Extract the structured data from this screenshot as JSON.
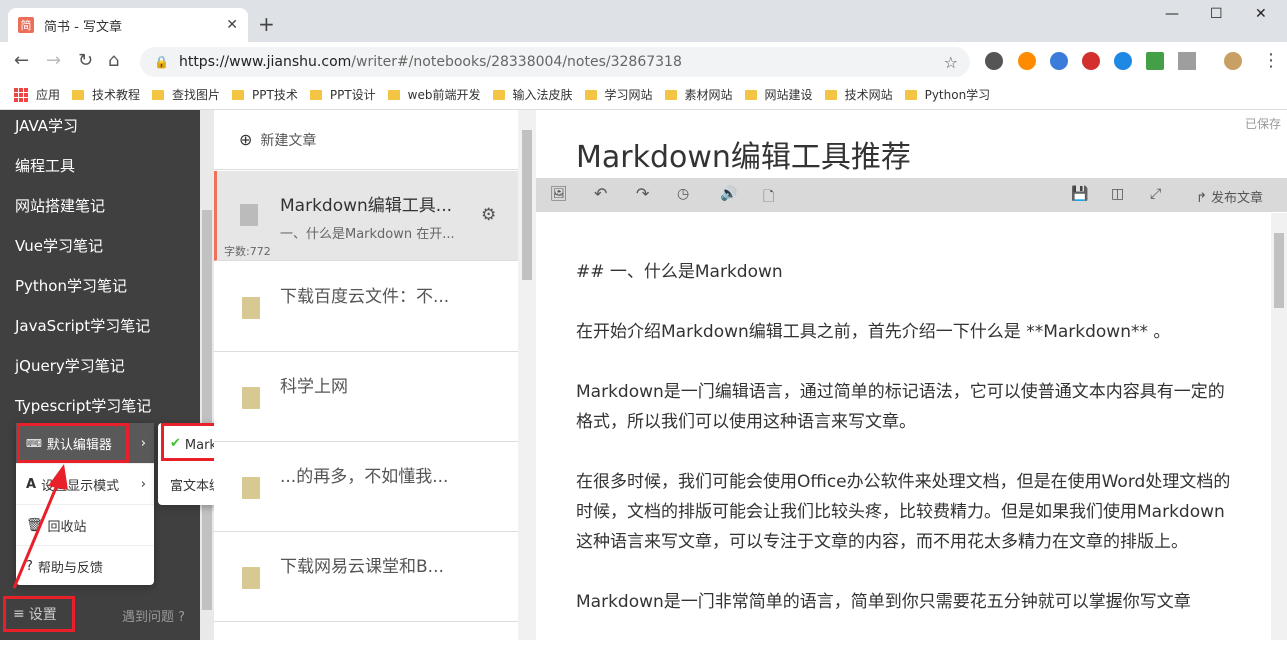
{
  "browser": {
    "tab_title": "简书 - 写文章",
    "favicon_text": "简",
    "url_host": "https://www.jianshu.com",
    "url_path": "/writer#/notebooks/28338004/notes/32867318",
    "bookmarks": [
      "应用",
      "技术教程",
      "查找图片",
      "PPT技术",
      "PPT设计",
      "web前端开发",
      "输入法皮肤",
      "学习网站",
      "素材网站",
      "网站建设",
      "技术网站",
      "Python学习"
    ]
  },
  "sidebar": {
    "notebooks": [
      "JAVA学习",
      "编程工具",
      "网站搭建笔记",
      "Vue学习笔记",
      "Python学习笔记",
      "JavaScript学习笔记",
      "jQuery学习笔记",
      "Typescript学习笔记"
    ],
    "menu": {
      "default_editor": "默认编辑器",
      "display_mode": "设置显示模式",
      "trash": "回收站",
      "help_feedback": "帮助与反馈"
    },
    "submenu": {
      "markdown": "MarkDown编辑器",
      "richtext": "富文本编辑器"
    },
    "settings_label": "设置",
    "help_label": "遇到问题"
  },
  "notelist": {
    "new_note": "新建文章",
    "notes": [
      {
        "title": "Markdown编辑工具...",
        "summary": "一、什么是Markdown 在开...",
        "word_count": "字数:772"
      },
      {
        "title": "下载百度云文件：不..."
      },
      {
        "title": "科学上网"
      },
      {
        "title": "...的再多，不如懂我..."
      },
      {
        "title": "下载网易云课堂和B..."
      }
    ]
  },
  "editor": {
    "saved": "已保存",
    "title": "Markdown编辑工具推荐",
    "publish": "发布文章",
    "paragraphs": [
      "## 一、什么是Markdown",
      "在开始介绍Markdown编辑工具之前，首先介绍一下什么是 **Markdown** 。",
      "Markdown是一门编辑语言，通过简单的标记语法，它可以使普通文本内容具有一定的格式，所以我们可以使用这种语言来写文章。",
      "在很多时候，我们可能会使用Office办公软件来处理文档，但是在使用Word处理文档的时候，文档的排版可能会让我们比较头疼，比较费精力。但是如果我们使用Markdown这种语言来写文章，可以专注于文章的内容，而不用花太多精力在文章的排版上。",
      "Markdown是一门非常简单的语言，简单到你只需要花五分钟就可以掌握你写文章"
    ]
  }
}
